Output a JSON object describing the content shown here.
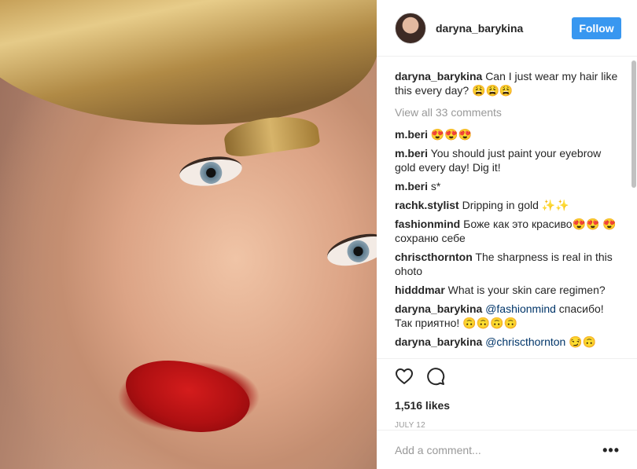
{
  "post": {
    "username": "daryna_barykina",
    "follow_label": "Follow",
    "caption": {
      "user": "daryna_barykina",
      "text": "Can I just wear my hair like this every day? 😩😩😩"
    },
    "view_all": "View all 33 comments",
    "comments": [
      {
        "user": "m.beri",
        "text": "😍😍😍",
        "mention": ""
      },
      {
        "user": "m.beri",
        "text": "You should just paint your eyebrow gold every day! Dig it!",
        "mention": ""
      },
      {
        "user": "m.beri",
        "text": "s*",
        "mention": ""
      },
      {
        "user": "rachk.stylist",
        "text": "Dripping in gold ✨✨",
        "mention": ""
      },
      {
        "user": "fashionmind",
        "text": "Боже как это красиво😍😍 😍сохраню себе",
        "mention": ""
      },
      {
        "user": "chriscthornton",
        "text": "The sharpness is real in this ohoto",
        "mention": ""
      },
      {
        "user": "hidddmar",
        "text": "What is your skin care regimen?",
        "mention": ""
      },
      {
        "user": "daryna_barykina",
        "mention": "@fashionmind",
        "text": "спасибо! Так приятно! 🙃🙃🙃🙃"
      },
      {
        "user": "daryna_barykina",
        "mention": "@chriscthornton",
        "text": "😏🙃"
      }
    ],
    "likes": "1,516 likes",
    "date": "JULY 12",
    "add_comment_placeholder": "Add a comment...",
    "more_label": "•••"
  },
  "icons": {
    "like": "heart-icon",
    "comment": "comment-bubble-icon",
    "more": "more-options-icon"
  },
  "colors": {
    "accent": "#3897f0",
    "mention": "#003569",
    "muted": "#999999"
  }
}
